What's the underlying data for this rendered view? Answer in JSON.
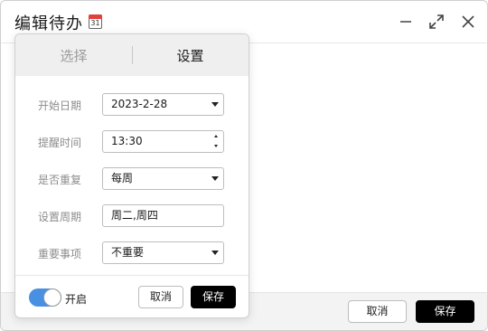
{
  "window": {
    "title": "编辑待办",
    "calendar_icon_day": "31",
    "controls": [
      "minimize-icon",
      "maximize-icon",
      "close-icon"
    ]
  },
  "footer": {
    "cancel_label": "取消",
    "save_label": "保存"
  },
  "popover": {
    "tabs": [
      {
        "label": "选择",
        "active": false
      },
      {
        "label": "设置",
        "active": true
      }
    ],
    "form": {
      "start_date": {
        "label": "开始日期",
        "value": "2023-2-28"
      },
      "reminder_time": {
        "label": "提醒时间",
        "value": "13:30"
      },
      "repeat": {
        "label": "是否重复",
        "value": "每周"
      },
      "cycle": {
        "label": "设置周期",
        "value": "周二,周四"
      },
      "importance": {
        "label": "重要事项",
        "value": "不重要"
      }
    },
    "toggle": {
      "label": "开启",
      "on": true,
      "color": "#4a90e2"
    },
    "cancel_label": "取消",
    "save_label": "保存"
  }
}
